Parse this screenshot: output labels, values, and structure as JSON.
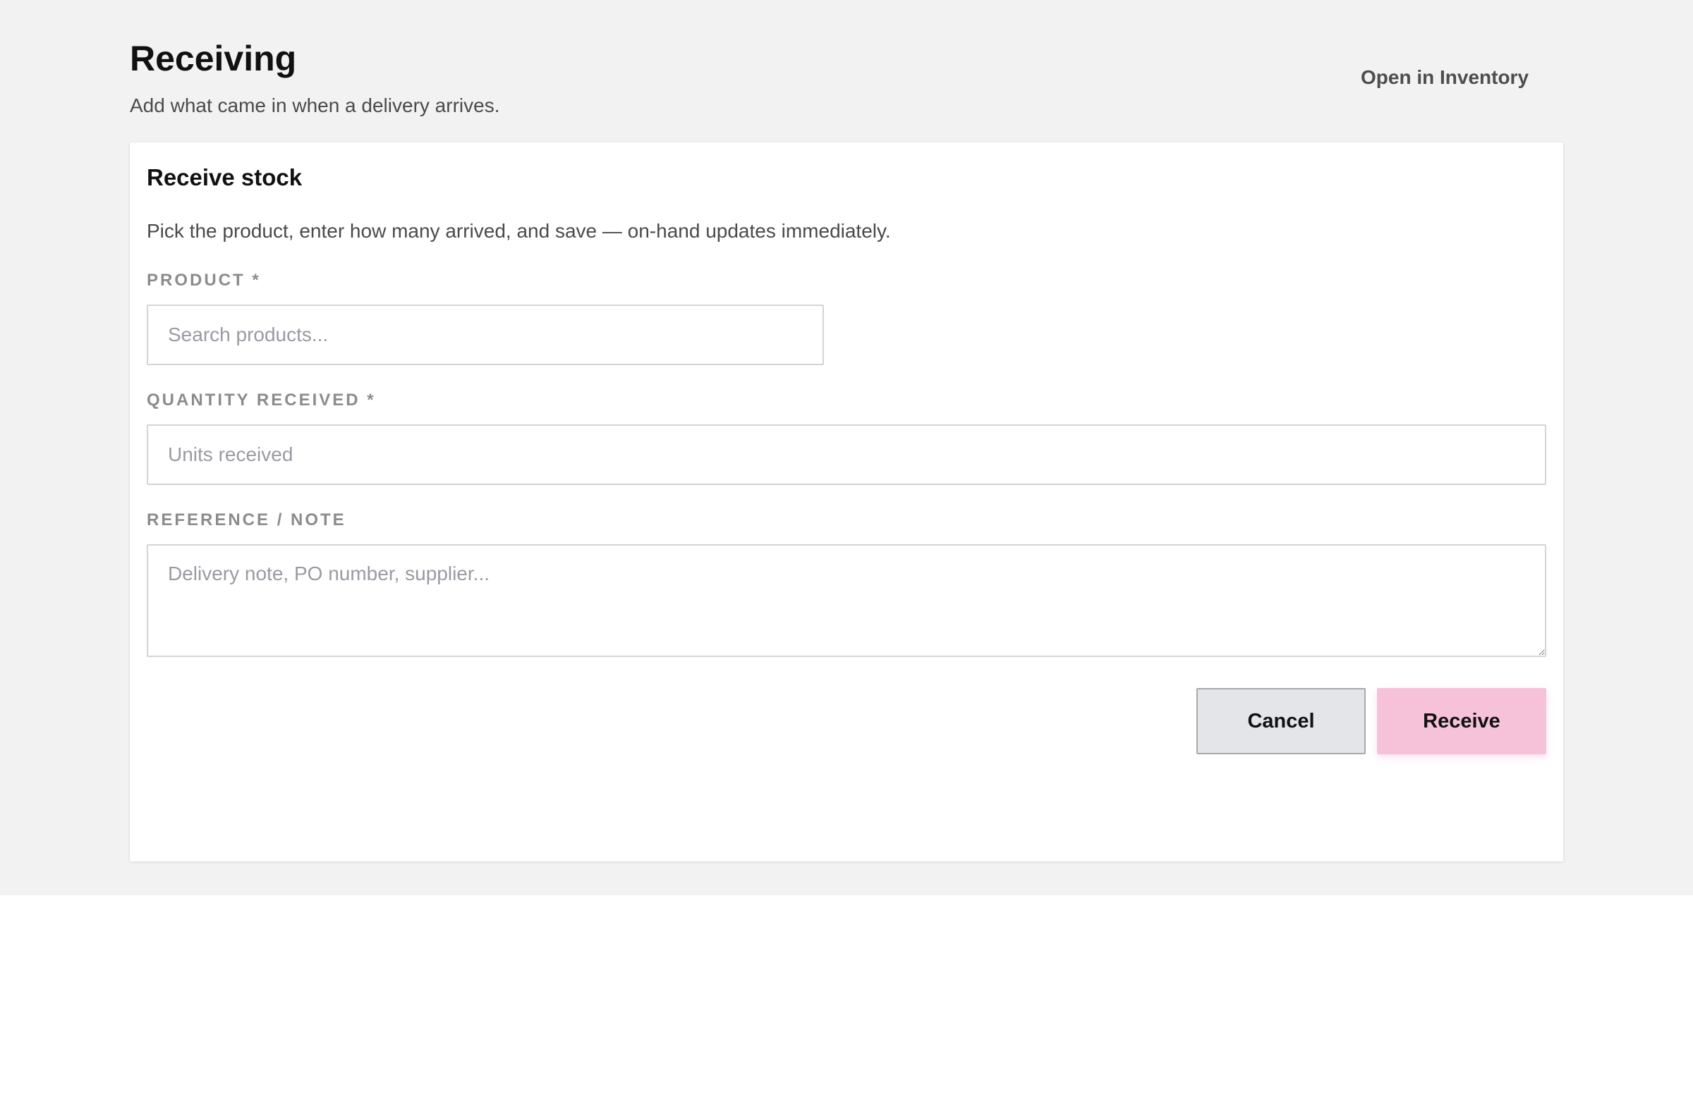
{
  "header": {
    "title": "Receiving",
    "subtitle": "Add what came in when a delivery arrives.",
    "open_inventory_label": "Open in Inventory"
  },
  "form": {
    "title": "Receive stock",
    "description": "Pick the product, enter how many arrived, and save — on-hand updates immediately.",
    "product": {
      "label": "PRODUCT *",
      "placeholder": "Search products...",
      "value": ""
    },
    "quantity": {
      "label": "QUANTITY RECEIVED *",
      "placeholder": "Units received",
      "value": ""
    },
    "reference": {
      "label": "REFERENCE / NOTE",
      "placeholder": "Delivery note, PO number, supplier...",
      "value": ""
    },
    "cancel_label": "Cancel",
    "receive_label": "Receive"
  },
  "colors": {
    "page_background": "#f2f2f2",
    "card_background": "#ffffff",
    "primary_button": "#f6c2da",
    "secondary_button": "#e3e5e9"
  }
}
